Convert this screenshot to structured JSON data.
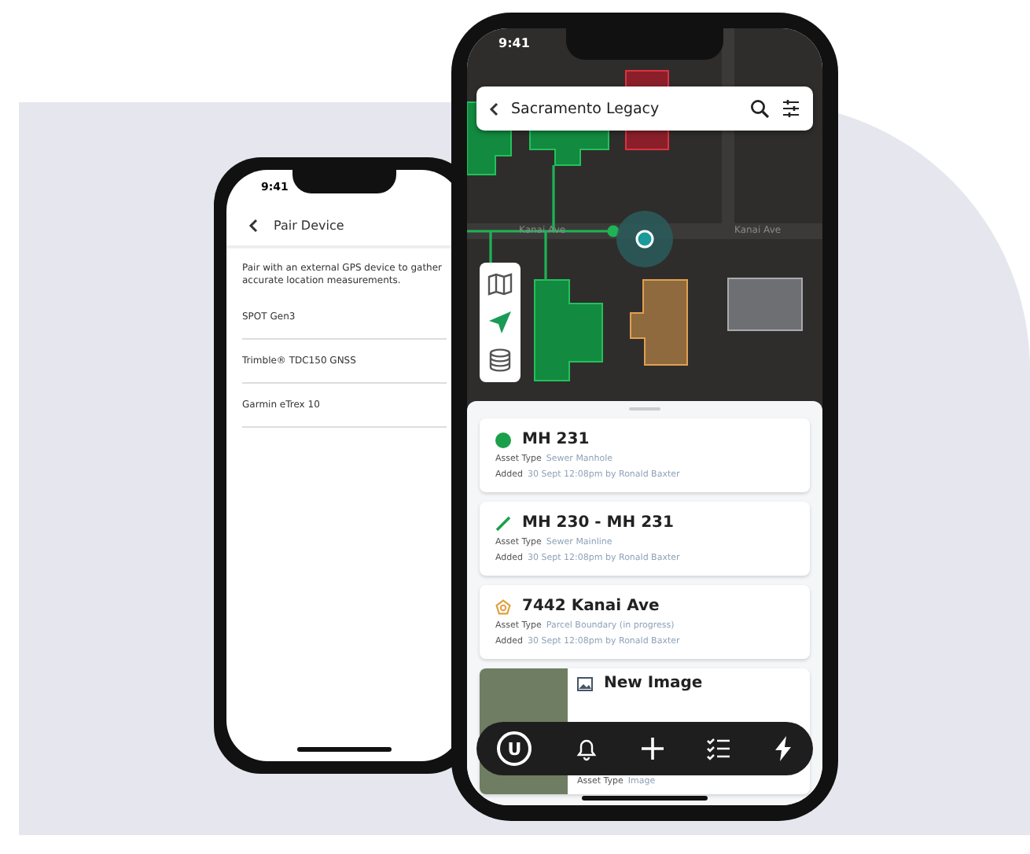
{
  "back_phone": {
    "status_time": "9:41",
    "title": "Pair Device",
    "description": "Pair with an external GPS device to gather accurate location measurements.",
    "devices": [
      {
        "name": "SPOT Gen3"
      },
      {
        "name": "Trimble® TDC150 GNSS"
      },
      {
        "name": "Garmin eTrex 10"
      }
    ]
  },
  "front_phone": {
    "status_time": "9:41",
    "search_bar": {
      "title": "Sacramento Legacy"
    },
    "map": {
      "street_labels": [
        "Kanai Ave",
        "Kanai Ave"
      ],
      "tools": [
        {
          "kind": "map",
          "selected": false
        },
        {
          "kind": "locate",
          "selected": true
        },
        {
          "kind": "layers",
          "selected": false
        }
      ]
    },
    "assets": [
      {
        "kind": "point",
        "name": "MH 231",
        "type_label": "Asset Type",
        "type": "Sewer Manhole",
        "added_label": "Added",
        "added": "30 Sept 12:08pm by Ronald Baxter"
      },
      {
        "kind": "line",
        "name": "MH 230 - MH 231",
        "type_label": "Asset Type",
        "type": "Sewer Mainline",
        "added_label": "Added",
        "added": "30 Sept 12:08pm by Ronald Baxter"
      },
      {
        "kind": "parcel",
        "name": "7442 Kanai Ave",
        "type_label": "Asset Type",
        "type": "Parcel Boundary (in progress)",
        "added_label": "Added",
        "added": "30 Sept 12:08pm by Ronald Baxter"
      },
      {
        "kind": "image",
        "name": "New Image",
        "type_label": "Asset Type",
        "type": "Image"
      }
    ],
    "nav": [
      {
        "kind": "logo",
        "letter": "U"
      },
      {
        "kind": "bell"
      },
      {
        "kind": "add"
      },
      {
        "kind": "checklist"
      },
      {
        "kind": "bolt"
      }
    ]
  }
}
